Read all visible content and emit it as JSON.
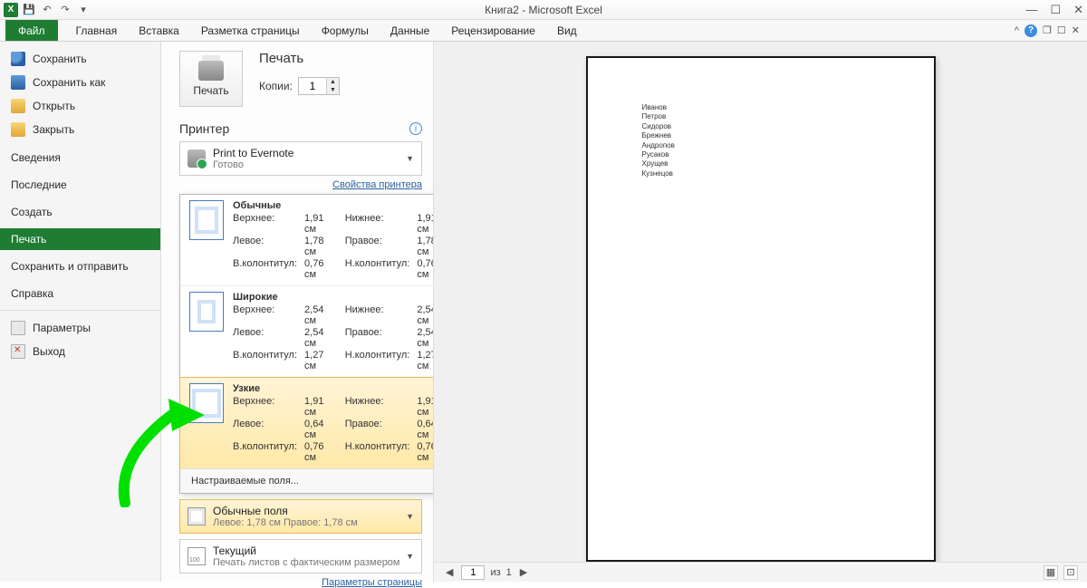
{
  "app": {
    "title": "Книга2  -  Microsoft Excel"
  },
  "window": {
    "minimize": "—",
    "maximize": "☐",
    "close": "✕"
  },
  "qat": {
    "save": "💾",
    "undo": "↶",
    "redo": "↷",
    "more": "▾"
  },
  "ribbon": {
    "file": "Файл",
    "tabs": [
      "Главная",
      "Вставка",
      "Разметка страницы",
      "Формулы",
      "Данные",
      "Рецензирование",
      "Вид"
    ],
    "help": "?",
    "caret": "^"
  },
  "backstage_menu": {
    "save": "Сохранить",
    "save_as": "Сохранить как",
    "open": "Открыть",
    "close": "Закрыть",
    "info": "Сведения",
    "recent": "Последние",
    "new": "Создать",
    "print": "Печать",
    "send": "Сохранить и отправить",
    "help": "Справка",
    "options": "Параметры",
    "exit": "Выход"
  },
  "print": {
    "title": "Печать",
    "button": "Печать",
    "copies_label": "Копии:",
    "copies_value": "1",
    "printer_title": "Принтер",
    "printer_name": "Print to Evernote",
    "printer_status": "Готово",
    "printer_props": "Свойства принтера",
    "page_setup": "Параметры страницы"
  },
  "margins_flyout": {
    "options": [
      {
        "title": "Обычные",
        "variant": "normal",
        "rows": [
          [
            "Верхнее:",
            "1,91 см",
            "Нижнее:",
            "1,91 см"
          ],
          [
            "Левое:",
            "1,78 см",
            "Правое:",
            "1,78 см"
          ],
          [
            "В.колонтитул:",
            "0,76 см",
            "Н.колонтитул:",
            "0,76 см"
          ]
        ]
      },
      {
        "title": "Широкие",
        "variant": "wide",
        "rows": [
          [
            "Верхнее:",
            "2,54 см",
            "Нижнее:",
            "2,54 см"
          ],
          [
            "Левое:",
            "2,54 см",
            "Правое:",
            "2,54 см"
          ],
          [
            "В.колонтитул:",
            "1,27 см",
            "Н.колонтитул:",
            "1,27 см"
          ]
        ]
      },
      {
        "title": "Узкие",
        "variant": "narrow",
        "selected": true,
        "rows": [
          [
            "Верхнее:",
            "1,91 см",
            "Нижнее:",
            "1,91 см"
          ],
          [
            "Левое:",
            "0,64 см",
            "Правое:",
            "0,64 см"
          ],
          [
            "В.колонтитул:",
            "0,76 см",
            "Н.колонтитул:",
            "0,76 см"
          ]
        ]
      }
    ],
    "custom": "Настраиваемые поля..."
  },
  "margins_dd": {
    "title": "Обычные поля",
    "sub": "Левое: 1,78 см    Правое: 1,78 см"
  },
  "scaling_dd": {
    "title": "Текущий",
    "sub": "Печать листов с фактическим размером"
  },
  "preview": {
    "rows": [
      "Иванов",
      "Петров",
      "Сидоров",
      "Брежнев",
      "Андропов",
      "Русаков",
      "Хрущев",
      "Кузнецов"
    ],
    "page_current": "1",
    "page_sep": "из",
    "page_total": "1"
  }
}
